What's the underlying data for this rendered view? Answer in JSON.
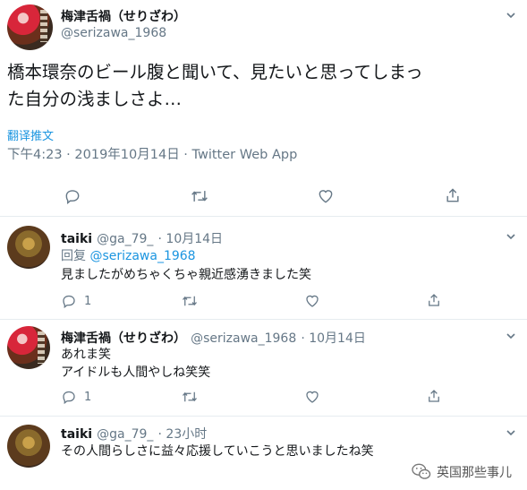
{
  "main_tweet": {
    "author_name": "梅津舌禍（せりざわ）",
    "author_handle": "@serizawa_1968",
    "text_line1": "橋本環奈のビール腹と聞いて、見たいと思ってしまっ",
    "text_line2": "た自分の浅ましさよ…",
    "translate_label": "翻译推文",
    "meta": "下午4:23 · 2019年10月14日 · Twitter Web App"
  },
  "replies": [
    {
      "author_name": "taiki",
      "author_handle": "@ga_79_",
      "date": "· 10月14日",
      "reply_to_label": "回复",
      "reply_to_handle": "@serizawa_1968",
      "lines": [
        "見ましたがめちゃくちゃ親近感湧きました笑"
      ],
      "reply_count": "1",
      "retweet_count": "",
      "like_count": ""
    },
    {
      "author_name": "梅津舌禍（せりざわ）",
      "author_handle": "@serizawa_1968",
      "date": "· 10月14日",
      "lines": [
        "あれま笑",
        "アイドルも人間やしね笑笑"
      ],
      "reply_count": "1",
      "retweet_count": "",
      "like_count": ""
    },
    {
      "author_name": "taiki",
      "author_handle": "@ga_79_",
      "date": "· 23小时",
      "lines": [
        "その人間らしさに益々応援していこうと思いましたね笑"
      ]
    }
  ],
  "watermark": "英国那些事儿",
  "icons": {
    "reply": "reply-icon",
    "retweet": "retweet-icon",
    "like": "heart-icon",
    "share": "share-icon",
    "more": "chevron-down-icon",
    "watermark": "wechat-icon"
  },
  "colors": {
    "link": "#1b95e0",
    "muted": "#657786",
    "text": "#14171a"
  }
}
